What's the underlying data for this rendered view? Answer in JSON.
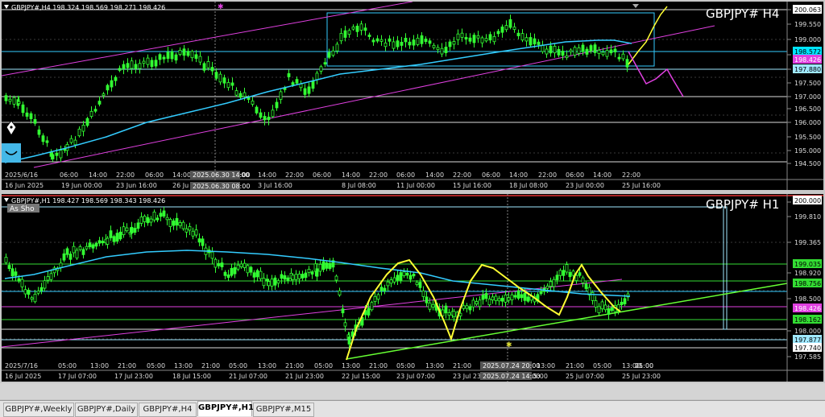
{
  "top_chart": {
    "info": "GBPJPY#,H4 198.324 198.569 198.271 198.426",
    "symbol_label": "GBPJPY#  H4",
    "price_ticks": [
      "200.063",
      "199.550",
      "199.000",
      "198.500",
      "198.000",
      "197.500",
      "197.000",
      "196.500",
      "196.000",
      "195.500",
      "195.000",
      "194.500"
    ],
    "price_badges": [
      {
        "text": "200.063",
        "color": "#000000",
        "bg": "#ffffff"
      },
      {
        "text": "198.572",
        "color": "#000000",
        "bg": "#00e5ff"
      },
      {
        "text": "198.426",
        "color": "#ffffff",
        "bg": "#e040e0"
      },
      {
        "text": "197.880",
        "color": "#000000",
        "bg": "#9fe8ff"
      }
    ],
    "time_ticks": [
      "16 Jun 2025",
      "19 Jun 00:00",
      "23 Jun 16:00",
      "26 Ju",
      "3 Jul 16:00",
      "8 Jul 08:00",
      "11 Jul 00:00",
      "15 Jul 16:00",
      "18 Jul 08:00",
      "23 Jul 00:00",
      "25 Jul 16:00"
    ],
    "time_ticks_small": [
      "2025/6/16",
      "06:00",
      "14:00",
      "22:00",
      "06:00",
      "14:00",
      "2025.06.30 14:00",
      "14:00",
      "22:00",
      "06:00",
      "14:00",
      "22:00",
      "06:00",
      "14:00",
      "22:00",
      "06:00",
      "14:00",
      "22:00",
      "06:00",
      "14:00",
      "22:00"
    ],
    "crosshair_date_top": "2025.06.30 14:00",
    "crosshair_date_bottom": "2025.06.30 08:00"
  },
  "bottom_chart": {
    "info": "GBPJPY#,H1 198.427 198.569 198.343 198.426",
    "symbol_label": "GBPJPY#  H1",
    "object_label": "As Sho",
    "price_ticks": [
      "200.000",
      "199.810",
      "199.365",
      "198.920",
      "198.500",
      "198.000",
      "197.585"
    ],
    "price_badges": [
      {
        "text": "200.000",
        "color": "#000000",
        "bg": "#ffffff"
      },
      {
        "text": "199.035",
        "color": "#000000",
        "bg": "#33dd33"
      },
      {
        "text": "198.756",
        "color": "#000000",
        "bg": "#33dd33"
      },
      {
        "text": "198.426",
        "color": "#ffffff",
        "bg": "#e040e0"
      },
      {
        "text": "198.162",
        "color": "#000000",
        "bg": "#33dd33"
      },
      {
        "text": "197.877",
        "color": "#000000",
        "bg": "#9fe8ff"
      },
      {
        "text": "197.740",
        "color": "#000000",
        "bg": "#ffffff"
      }
    ],
    "time_ticks_small": [
      "2025/7/16",
      "05:00",
      "13:00",
      "21:00",
      "05:00",
      "13:00",
      "21:00",
      "05:00",
      "13:00",
      "21:00",
      "05:00",
      "13:00",
      "21:00",
      "05:00",
      "13:00",
      "21:00",
      "05:00",
      "13:00",
      "21:00",
      "05:00",
      "13:00",
      "21:00",
      "05:00"
    ],
    "time_ticks": [
      "16 Jul 2025",
      "17 Jul 07:00",
      "17 Jul 23:00",
      "18 Jul 15:00",
      "21 Jul 07:00",
      "21 Jul 23:00",
      "22 Jul 15:00",
      "23 Jul 07:00",
      "23 Jul 23:00",
      "24 Jul 15:00",
      "25 Jul 07:00",
      "25 Jul 23:00"
    ],
    "crosshair_date_top": "2025.07.24 20:00",
    "crosshair_date_bottom": "2025.07.24 14:00"
  },
  "tabs": [
    {
      "label": "GBPJPY#,Weekly",
      "active": false
    },
    {
      "label": "GBPJPY#,Daily",
      "active": false
    },
    {
      "label": "GBPJPY#,H4",
      "active": false
    },
    {
      "label": "GBPJPY#,H1",
      "active": true
    },
    {
      "label": "GBPJPY#,M15",
      "active": false
    }
  ],
  "colors": {
    "background": "#000000",
    "candles": "#33ff33",
    "ma_line": "#33ccff",
    "channel": "#e040e0",
    "yellow_path": "#ffff33",
    "trendline": "#66ff33"
  }
}
